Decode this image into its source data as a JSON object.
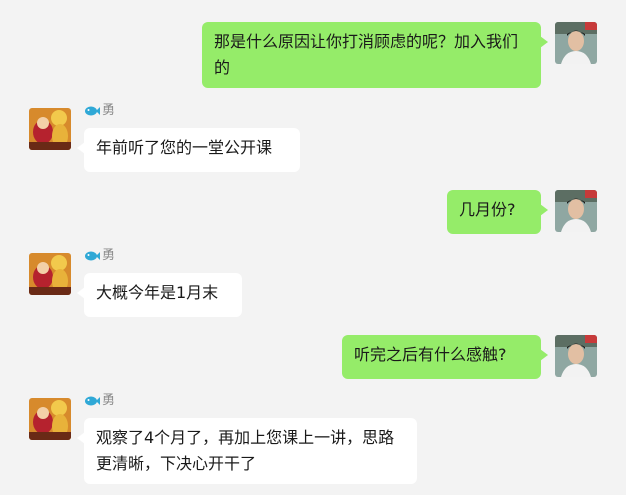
{
  "messages": [
    {
      "side": "me",
      "text": "那是什么原因让你打消顾虑的呢？加入我们的"
    },
    {
      "side": "other",
      "sender": "勇",
      "text": "年前听了您的一堂公开课"
    },
    {
      "side": "me",
      "text": "几月份?"
    },
    {
      "side": "other",
      "sender": "勇",
      "text": "大概今年是1月末"
    },
    {
      "side": "me",
      "text": "听完之后有什么感触?"
    },
    {
      "side": "other",
      "sender": "勇",
      "text": "观察了4个月了，再加上您课上一讲，思路更清晰，下决心开干了"
    }
  ],
  "icons": {
    "sender_badge": "fish-emoji-icon"
  },
  "colors": {
    "me_bubble": "#95ec69",
    "other_bubble": "#ffffff",
    "background": "#f3f3f3"
  }
}
